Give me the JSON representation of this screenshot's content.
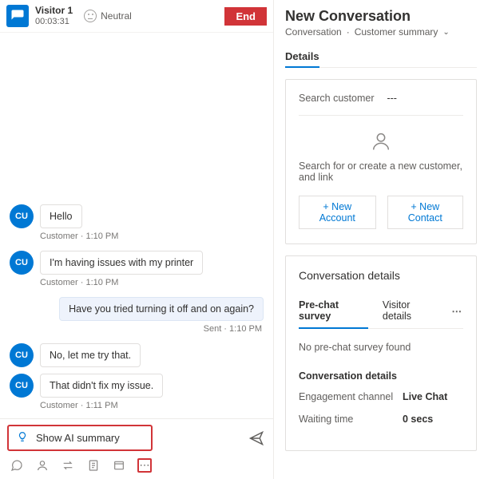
{
  "header": {
    "visitor_name": "Visitor 1",
    "timer": "00:03:31",
    "sentiment": "Neutral",
    "end_label": "End"
  },
  "messages": [
    {
      "from": "customer",
      "avatar": "CU",
      "text": "Hello",
      "meta": "Customer · 1:10 PM"
    },
    {
      "from": "customer",
      "avatar": "CU",
      "text": "I'm having issues with my printer",
      "meta": "Customer · 1:10 PM"
    },
    {
      "from": "agent",
      "text": "Have you tried turning it off and on again?",
      "meta": "Sent · 1:10 PM"
    },
    {
      "from": "customer",
      "avatar": "CU",
      "text": "No, let me try that.",
      "meta": ""
    },
    {
      "from": "customer",
      "avatar": "CU",
      "text": "That didn't fix my issue.",
      "meta": "Customer · 1:11 PM"
    }
  ],
  "ai_summary_label": "Show AI summary",
  "right": {
    "title": "New Conversation",
    "breadcrumb_a": "Conversation",
    "breadcrumb_b": "Customer summary",
    "tab_details": "Details",
    "search_label": "Search customer",
    "search_value": "---",
    "empty_text": "Search for or create a new customer, and link",
    "new_account": "+ New Account",
    "new_contact": "+ New Contact",
    "conv_title": "Conversation details",
    "subtab_a": "Pre-chat survey",
    "subtab_b": "Visitor details",
    "no_survey": "No pre-chat survey found",
    "conv_det_heading": "Conversation details",
    "rows": [
      {
        "k": "Engagement channel",
        "v": "Live Chat"
      },
      {
        "k": "Waiting time",
        "v": "0 secs"
      }
    ]
  }
}
